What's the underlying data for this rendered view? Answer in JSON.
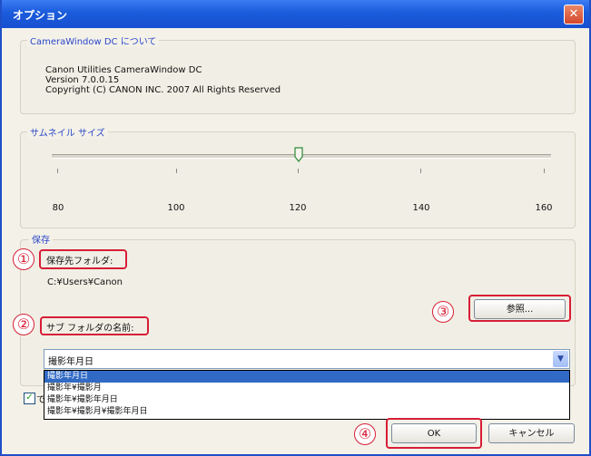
{
  "window": {
    "title": "オプション",
    "close_glyph": "✕"
  },
  "about": {
    "group_label": "CameraWindow DC について",
    "line1": "Canon Utilities CameraWindow DC",
    "line2": "Version 7.0.0.15",
    "line3": "Copyright (C) CANON INC. 2007 All Rights Reserved"
  },
  "thumbnail": {
    "group_label": "サムネイル サイズ",
    "tick_labels": [
      "80",
      "100",
      "120",
      "140",
      "160"
    ],
    "value": 120
  },
  "save": {
    "group_label": "保存",
    "folder_label": "保存先フォルダ:",
    "folder_path": "C:¥Users¥Canon",
    "browse_label": "参照...",
    "subfolder_label": "サブ フォルダの名前:",
    "subfolder_value": "撮影年月日",
    "subfolder_options": [
      "撮影年月日",
      "撮影年¥撮影月",
      "撮影年¥撮影年月日",
      "撮影年¥撮影月¥撮影年月日"
    ],
    "checkbox_checked": true
  },
  "buttons": {
    "ok": "OK",
    "cancel": "キャンセル"
  },
  "callouts": [
    "①",
    "②",
    "③",
    "④"
  ],
  "colors": {
    "title_bar": "#1a5bdc",
    "callout_red": "#d71e36",
    "selection": "#316ac5"
  }
}
